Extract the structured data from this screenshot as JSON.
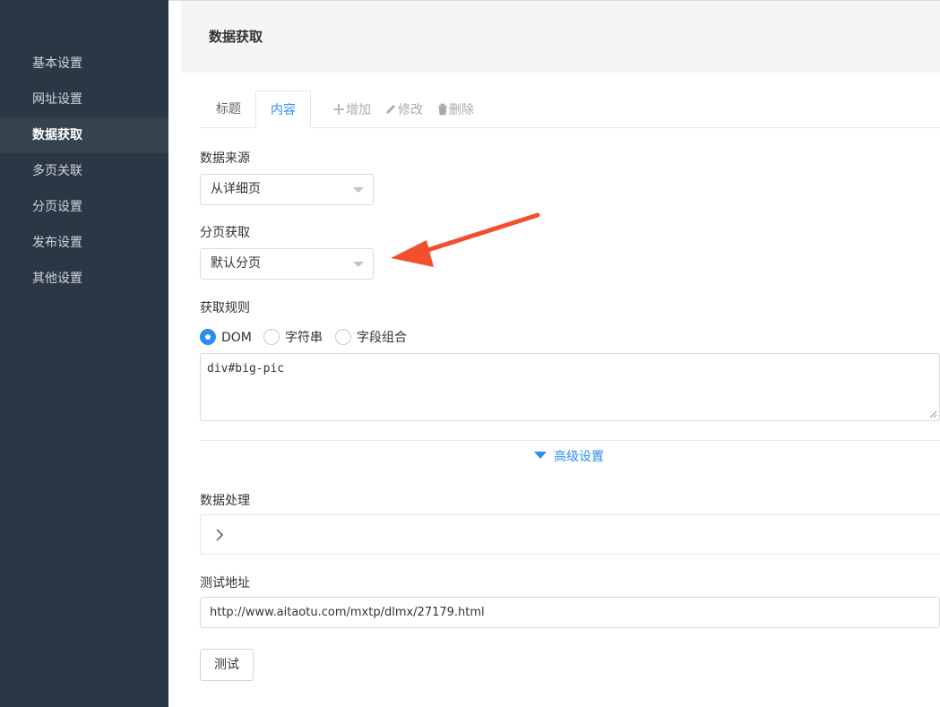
{
  "sidebar": {
    "items": [
      {
        "label": "基本设置"
      },
      {
        "label": "网址设置"
      },
      {
        "label": "数据获取",
        "active": true
      },
      {
        "label": "多页关联"
      },
      {
        "label": "分页设置"
      },
      {
        "label": "发布设置"
      },
      {
        "label": "其他设置"
      }
    ]
  },
  "header": {
    "title": "数据获取"
  },
  "tabs": [
    {
      "label": "标题"
    },
    {
      "label": "内容",
      "active": true
    }
  ],
  "toolbar": {
    "add_label": "增加",
    "edit_label": "修改",
    "delete_label": "删除"
  },
  "form": {
    "source": {
      "label": "数据来源",
      "value": "从详细页"
    },
    "paging": {
      "label": "分页获取",
      "value": "默认分页"
    },
    "rule": {
      "label": "获取规则",
      "options": [
        {
          "label": "DOM",
          "checked": true
        },
        {
          "label": "字符串"
        },
        {
          "label": "字段组合"
        }
      ],
      "value": "div#big-pic"
    },
    "advanced_label": "高级设置",
    "processing": {
      "label": "数据处理"
    },
    "test_url": {
      "label": "测试地址",
      "value": "http://www.aitaotu.com/mxtp/dlmx/27179.html"
    },
    "test_button": "测试"
  },
  "colors": {
    "sidebar_bg": "#2b3745",
    "accent": "#2d8cf0",
    "annotation_arrow": "#f2502c"
  }
}
